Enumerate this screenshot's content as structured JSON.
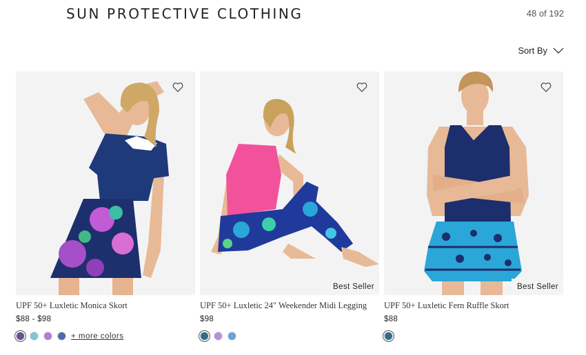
{
  "header": {
    "title": "SUN PROTECTIVE CLOTHING",
    "count": "48 of 192"
  },
  "sort": {
    "label": "Sort By"
  },
  "products": [
    {
      "name": "UPF 50+ Luxletic Monica Skort",
      "price": "$88 - $98",
      "badge": "",
      "swatches": [
        "#6a4f93",
        "#7ec6d6",
        "#b27fd0",
        "#4a6fa8"
      ],
      "more_colors": "+ more colors"
    },
    {
      "name": "UPF 50+ Luxletic 24\" Weekender Midi Legging",
      "price": "$98",
      "badge": "Best Seller",
      "swatches": [
        "#2c6e86",
        "#b98fdc",
        "#6aa3d8"
      ],
      "more_colors": ""
    },
    {
      "name": "UPF 50+ Luxletic Fern Ruffle Skort",
      "price": "$88",
      "badge": "Best Seller",
      "swatches": [
        "#2f6d94"
      ],
      "more_colors": ""
    }
  ],
  "colors": {
    "navy": "#1f3a7a",
    "pink": "#f2529b",
    "leopard_blue": "#2ba6d8",
    "skin": "#e8b996",
    "hair": "#c9a15c"
  }
}
